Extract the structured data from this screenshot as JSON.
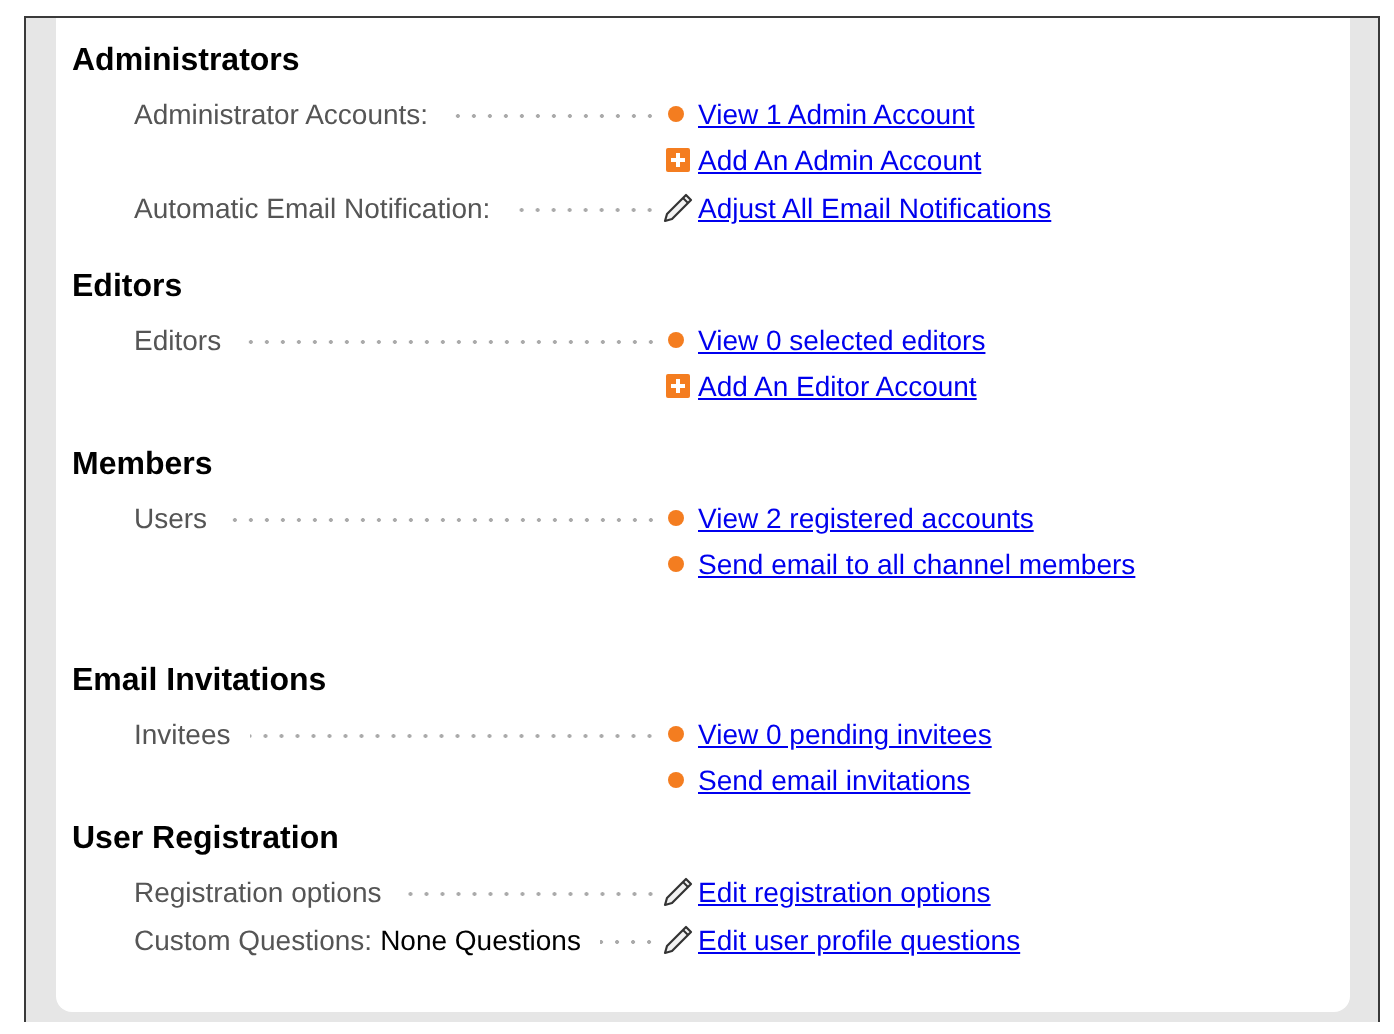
{
  "sections": [
    {
      "title": "Administrators",
      "rows": [
        {
          "label": "Administrator Accounts:",
          "links": [
            {
              "kind": "dot",
              "text": "View 1 Admin Account"
            },
            {
              "kind": "plus",
              "text": "Add An Admin Account"
            }
          ]
        },
        {
          "label": "Automatic Email Notification:",
          "links": [
            {
              "kind": "pencil",
              "text": "Adjust All Email Notifications"
            }
          ]
        }
      ]
    },
    {
      "title": "Editors",
      "rows": [
        {
          "label": "Editors",
          "links": [
            {
              "kind": "dot",
              "text": "View 0 selected editors"
            },
            {
              "kind": "plus",
              "text": "Add An Editor Account"
            }
          ]
        }
      ]
    },
    {
      "title": "Members",
      "rows": [
        {
          "label": "Users",
          "links": [
            {
              "kind": "dot",
              "text": "View 2 registered accounts"
            },
            {
              "kind": "dot",
              "text": "Send email to all channel members"
            }
          ]
        }
      ]
    },
    {
      "title": "Email Invitations",
      "rows": [
        {
          "label": "Invitees",
          "links": [
            {
              "kind": "dot",
              "text": "View 0 pending invitees"
            },
            {
              "kind": "dot",
              "text": "Send email invitations"
            }
          ]
        }
      ]
    },
    {
      "title": "User Registration",
      "rows": [
        {
          "label": "Registration options",
          "links": [
            {
              "kind": "pencil",
              "text": "Edit registration options"
            }
          ]
        },
        {
          "label": "Custom Questions:",
          "value": "None Questions",
          "links": [
            {
              "kind": "pencil",
              "text": "Edit user profile questions"
            }
          ]
        }
      ]
    }
  ]
}
